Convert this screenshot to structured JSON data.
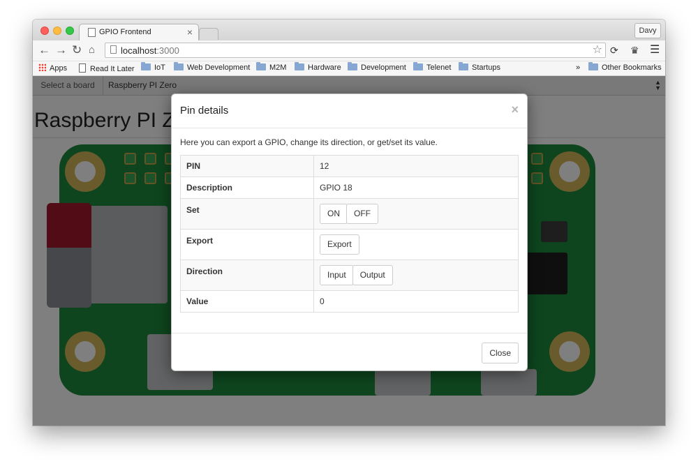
{
  "browser": {
    "tab_title": "GPIO Frontend",
    "profile_name": "Davy",
    "url_host": "localhost",
    "url_port": ":3000",
    "bookmarks": [
      {
        "label": "Apps",
        "icon": "apps-icon"
      },
      {
        "label": "Read It Later",
        "icon": "page-icon"
      },
      {
        "label": "IoT",
        "icon": "folder-icon"
      },
      {
        "label": "Web Development",
        "icon": "folder-icon"
      },
      {
        "label": "M2M",
        "icon": "folder-icon"
      },
      {
        "label": "Hardware",
        "icon": "folder-icon"
      },
      {
        "label": "Development",
        "icon": "folder-icon"
      },
      {
        "label": "Telenet",
        "icon": "folder-icon"
      },
      {
        "label": "Startups",
        "icon": "folder-icon"
      }
    ],
    "overflow_label": "»",
    "other_bookmarks": "Other Bookmarks"
  },
  "page": {
    "select_label": "Select a board",
    "selected_board": "Raspberry PI Zero",
    "title": "Raspberry PI Zero"
  },
  "modal": {
    "title": "Pin details",
    "intro": "Here you can export a GPIO, change its direction, or get/set its value.",
    "rows": {
      "pin": {
        "label": "PIN",
        "value": "12"
      },
      "description": {
        "label": "Description",
        "value": "GPIO 18"
      },
      "set": {
        "label": "Set",
        "on": "ON",
        "off": "OFF"
      },
      "export": {
        "label": "Export",
        "button": "Export"
      },
      "direction": {
        "label": "Direction",
        "input": "Input",
        "output": "Output"
      },
      "value": {
        "label": "Value",
        "value": "0"
      }
    },
    "close_label": "Close"
  },
  "colors": {
    "pcb_green": "#1d8a3c",
    "overlay": "rgba(0,0,0,0.5)"
  }
}
